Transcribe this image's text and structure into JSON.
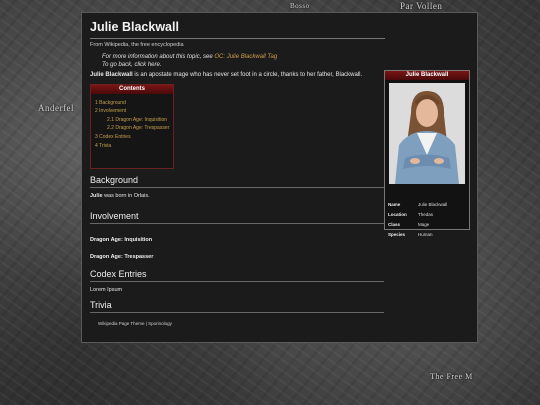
{
  "map_labels": {
    "top_left": "Bosso",
    "top_right": "Par Vollen",
    "left": "Anderfel",
    "bottom_right": "The Free M"
  },
  "article": {
    "title": "Julie Blackwall",
    "tagline": "From Wikipedia, the free encyclopedia",
    "hatnote_prefix": "For more information about this topic, see ",
    "hatnote_link": "OC: Julie Blackwall Tag",
    "hatnote_back_prefix": "To go back, click ",
    "hatnote_back_link": "here",
    "intro_name": "Julie Blackwall",
    "intro_rest": " is an apostate mage who has never set foot in a circle, thanks to her father, Blackwall."
  },
  "toc": {
    "title": "Contents",
    "items": [
      "1 Background",
      "2 Involvement",
      "2.1 Dragon Age: Inquisition",
      "2.2 Dragon Age: Trespasser",
      "3 Codex Entries",
      "4 Trivia"
    ]
  },
  "infobox": {
    "title": "Julie Blackwall",
    "rows": [
      {
        "key": "Name",
        "value": "Julie Blackwall"
      },
      {
        "key": "Location",
        "value": "Thedas"
      },
      {
        "key": "Class",
        "value": "Mage"
      },
      {
        "key": "Species",
        "value": "Human"
      }
    ]
  },
  "sections": {
    "background": {
      "heading": "Background",
      "name": "Julie",
      "text": " was born in Orlais."
    },
    "involvement": {
      "heading": "Involvement",
      "sub1": "Dragon Age: Inquisition",
      "sub2": "Dragon Age: Trespasser"
    },
    "codex": {
      "heading": "Codex Entries",
      "text": "Lorem Ipsum"
    },
    "trivia": {
      "heading": "Trivia"
    }
  },
  "footer": "Wikipedia Page Theme | Sporinology"
}
